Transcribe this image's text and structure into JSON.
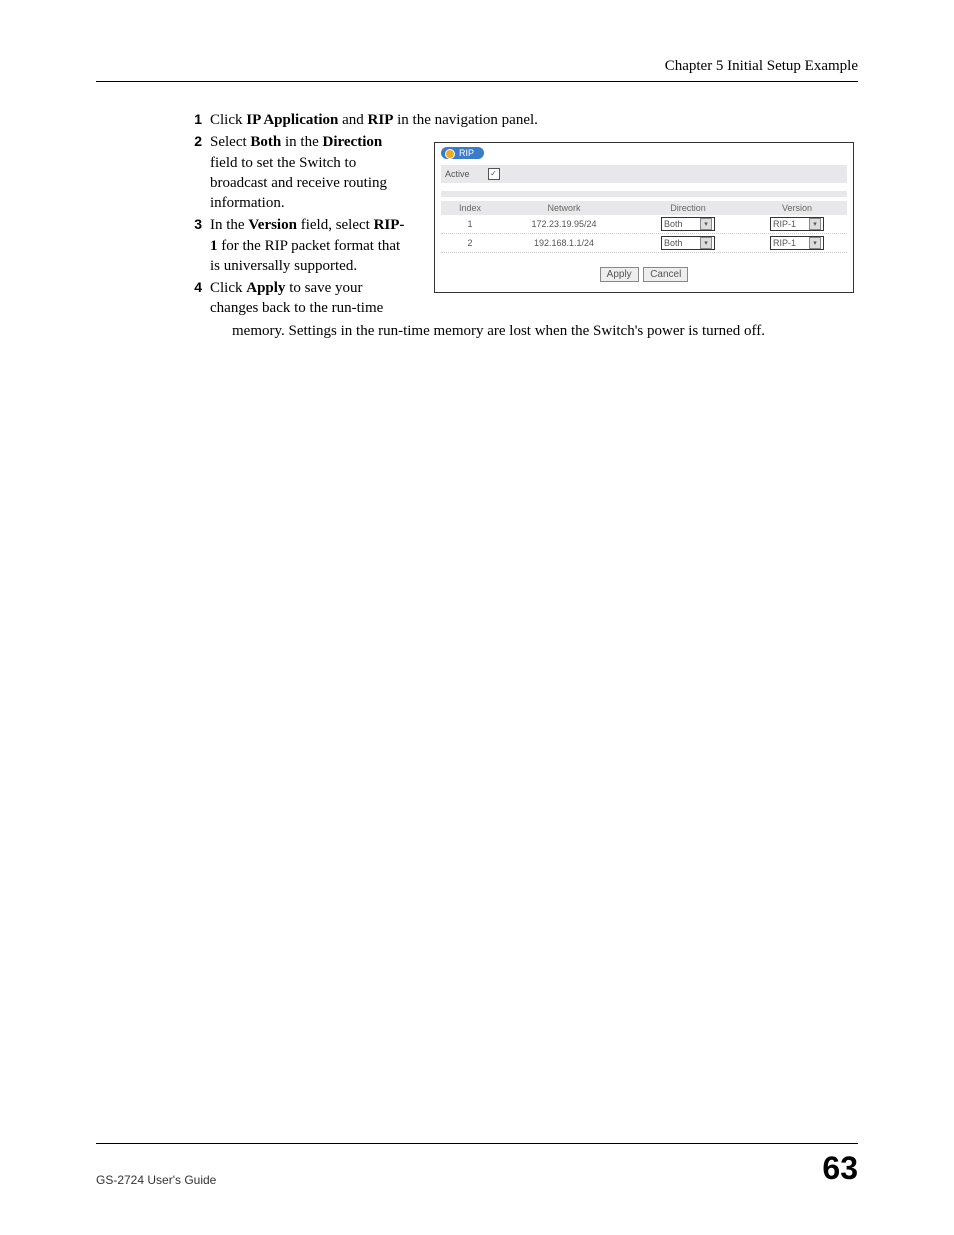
{
  "header": {
    "chapter": "Chapter 5 Initial Setup Example"
  },
  "steps": {
    "s1": {
      "num": "1",
      "t1": "Click ",
      "b1": "IP Application",
      "t2": " and ",
      "b2": "RIP",
      "t3": " in the navigation panel."
    },
    "s2": {
      "num": "2",
      "t1": "Select ",
      "b1": "Both",
      "t2": " in the ",
      "b2": "Direction",
      "t3": " field to set the Switch to broadcast and receive routing information."
    },
    "s3": {
      "num": "3",
      "t1": "In the ",
      "b1": "Version",
      "t2": " field, select ",
      "b2": "RIP-1",
      "t3": " for the RIP packet format that is universally supported."
    },
    "s4": {
      "num": "4",
      "t1": "Click ",
      "b1": "Apply",
      "t2": " to save your changes back to the run-time",
      "cont": "memory. Settings in the run-time memory are lost when the Switch's power is turned off."
    }
  },
  "panel": {
    "tab": "RIP",
    "active_label": "Active",
    "active_checked": "✓",
    "headers": {
      "index": "Index",
      "network": "Network",
      "direction": "Direction",
      "version": "Version"
    },
    "rows": [
      {
        "index": "1",
        "network": "172.23.19.95/24",
        "direction": "Both",
        "version": "RIP-1"
      },
      {
        "index": "2",
        "network": "192.168.1.1/24",
        "direction": "Both",
        "version": "RIP-1"
      }
    ],
    "apply": "Apply",
    "cancel": "Cancel"
  },
  "footer": {
    "guide": "GS-2724 User's Guide",
    "page": "63"
  }
}
